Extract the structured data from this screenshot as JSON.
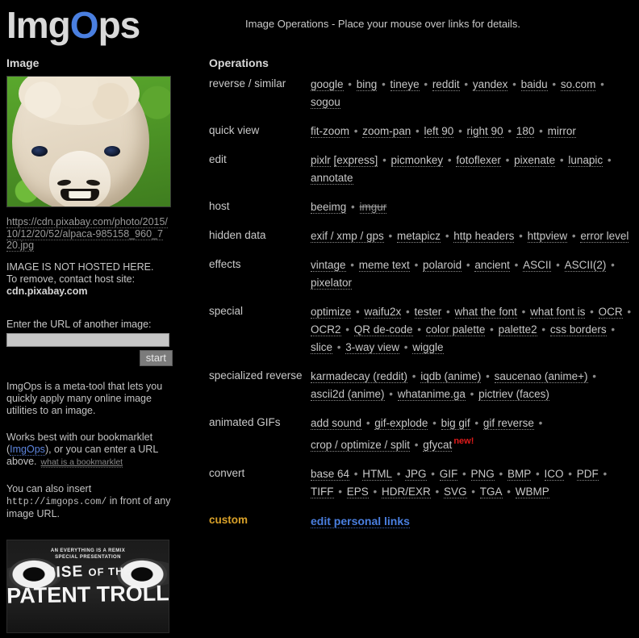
{
  "logo": {
    "pre": "Img",
    "accent": "O",
    "post": "ps",
    "accent_color": "#4a7fe0"
  },
  "header": {
    "tagline": "Image Operations  -  Place your mouse over links for details."
  },
  "sidebar": {
    "heading": "Image",
    "image_alt": "alpaca-photo-thumbnail",
    "image_url": "https://cdn.pixabay.com/photo/2015/10/12/20/52/alpaca-985158_960_720.jpg",
    "not_hosted_line1": "IMAGE IS NOT HOSTED HERE.",
    "not_hosted_line2": "To remove, contact host site:",
    "host_site": "cdn.pixabay.com",
    "url_prompt": "Enter the URL of another image:",
    "url_input_value": "",
    "url_input_placeholder": "",
    "start_label": "start",
    "blurb1": "ImgOps is a meta-tool that lets you quickly apply many online image utilities to an image.",
    "blurb2_pre": "Works best with our bookmarklet (",
    "blurb2_link": "ImgOps",
    "blurb2_post": "), or you can enter a URL above.",
    "bookmarklet_hint": "what is a bookmarklet",
    "blurb3_pre": "You can also insert",
    "blurb3_mono": "http://imgops.com/",
    "blurb3_post": "in front of any image URL.",
    "video": {
      "superline": "AN EVERYTHING IS A REMIX\nSPECIAL PRESENTATION",
      "title_line1_a": "RISE ",
      "title_line1_b": "OF THE",
      "title_line2": "PATENT TROLL"
    }
  },
  "operations": {
    "heading": "Operations",
    "rows": [
      {
        "label": "reverse / similar",
        "links": [
          "google",
          "bing",
          "tineye",
          "reddit",
          "yandex",
          "baidu",
          "so.com",
          "sogou"
        ]
      },
      {
        "label": "quick view",
        "links": [
          "fit-zoom",
          "zoom-pan",
          "left 90",
          "right 90",
          "180",
          "mirror"
        ]
      },
      {
        "label": "edit",
        "links": [
          "pixlr",
          "[express]",
          "picmonkey",
          "fotoflexer",
          "pixenate",
          "lunapic",
          "annotate"
        ],
        "nosep_after": [
          0
        ]
      },
      {
        "label": "host",
        "links": [
          "beeimg",
          "imgur"
        ],
        "strike": [
          1
        ]
      },
      {
        "label": "hidden data",
        "links": [
          "exif / xmp / gps",
          "metapicz",
          "http headers",
          "httpview",
          "error level"
        ]
      },
      {
        "label": "effects",
        "links": [
          "vintage",
          "meme text",
          "polaroid",
          "ancient",
          "ASCII",
          "ASCII(2)",
          "pixelator"
        ]
      },
      {
        "label": "special",
        "links": [
          "optimize",
          "waifu2x",
          "tester",
          "what the font",
          "what font is",
          "OCR",
          "OCR2",
          "QR de-code",
          "color palette",
          "palette2",
          "css borders",
          "slice",
          "3-way view",
          "wiggle"
        ],
        "wrap": [
          12
        ]
      },
      {
        "label": "specialized reverse",
        "links": [
          "karmadecay (reddit)",
          "iqdb (anime)",
          "saucenao (anime+)",
          "ascii2d (anime)",
          "whatanime.ga",
          "pictriev (faces)"
        ]
      },
      {
        "label": "animated GIFs",
        "links": [
          "add sound",
          "gif-explode",
          "big gif",
          "gif reverse",
          "crop / optimize / split",
          "gfycat"
        ],
        "badge_after": {
          "index": 5,
          "text": "new!",
          "color": "#e01b1b"
        }
      },
      {
        "label": "convert",
        "links": [
          "base 64",
          "HTML",
          "JPG",
          "GIF",
          "PNG",
          "BMP",
          "ICO",
          "PDF",
          "TIFF",
          "EPS",
          "HDR/EXR",
          "SVG",
          "TGA",
          "WBMP"
        ]
      },
      {
        "label": "custom",
        "custom": true,
        "links": [
          "edit personal links"
        ]
      }
    ]
  }
}
